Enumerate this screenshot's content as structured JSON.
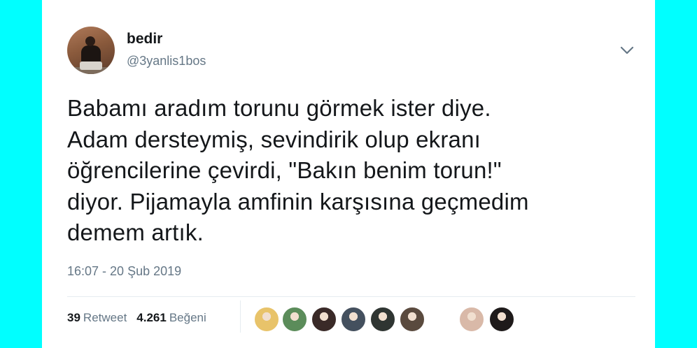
{
  "tweet": {
    "author_name": "bedir",
    "author_handle": "@3yanlis1bos",
    "text_lines": [
      "Babamı aradım torunu görmek ister diye.",
      "Adam dersteymiş, sevindirik olup ekranı",
      "öğrencilerine çevirdi, \"Bakın benim torun!\"",
      "diyor. Pijamayla amfinin karşısına geçmedim",
      "demem artık."
    ],
    "timestamp": "16:07 - 20 Şub 2019",
    "retweet_count": "39",
    "retweet_label": "Retweet",
    "like_count": "4.261",
    "like_label": "Beğeni"
  },
  "likers": [
    {
      "icon": "avatar",
      "color": "#e8c36a"
    },
    {
      "icon": "avatar",
      "color": "#5b8c5a"
    },
    {
      "icon": "avatar",
      "color": "#3a2a28"
    },
    {
      "icon": "avatar",
      "color": "#44505e"
    },
    {
      "icon": "avatar",
      "color": "#2f3532"
    },
    {
      "icon": "avatar",
      "color": "#5a4a3e"
    },
    {
      "icon": "avatar",
      "color": "#d9b9a8"
    },
    {
      "icon": "avatar",
      "color": "#1e1a1a"
    }
  ],
  "colors": {
    "background": "#00ffff",
    "card": "#ffffff",
    "text_primary": "#14171a",
    "text_secondary": "#657786",
    "divider": "#e6ecf0"
  }
}
